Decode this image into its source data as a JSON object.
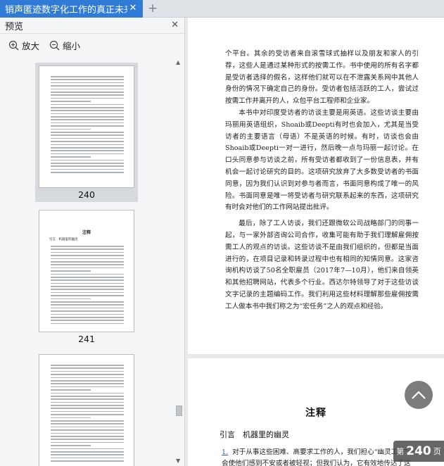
{
  "tab": {
    "title": "销声匿迹数字化工作的真正未来",
    "close": "✕",
    "add": "+"
  },
  "sidebar": {
    "title": "预览",
    "close": "✕",
    "zoom_in": "放大",
    "zoom_out": "缩小",
    "thumbnails": [
      {
        "page": "240"
      },
      {
        "page": "241",
        "title": "注释",
        "subtitle": "引言　机器里的幽灵"
      },
      {
        "page": ""
      }
    ]
  },
  "document": {
    "paragraphs": [
      "个平台。其余的受访者来自滚雪球式抽样以及朋友和家人的引荐，这些人是通过某种形式的按需工作。书中使用的所有名字都是受访者选择的假名，这样他们就可以在不泄露关系网中其他人身份的情况下确定自己的身份。受访者包括活跃的工人，尝试过按需工作并离开的人，众包平台工程师和企业家。",
      "本书中对印度受访者的访谈主要是用英语。这些访谈主要由玛丽用英语组织，Shoaib或Deepti有时也会加入，尤其是当受访者的主要语言（母语）不是英语的时候。有时，访谈也会由Shoaib或Deepti一对一进行，然后晚一点与玛丽一起讨论。在口头同意参与访谈之前，所有受访者都收到了一份信息表，并有机会一起讨论研究的目的。这项研究放弃了大多数受访者的书面同意，因为我们认识到对参与者而言，书面同意构成了唯一的风险。书面同意是唯一将受访者与研究联系起来的东西，这项研究有时会对他们的工作网站提出批评。",
      "最后，除了工人访谈，我们还跟微软公司战略部门的同事一起，与一家外部咨询公司合作，收集可能有助于我们理解雇佣按需工人的观点的访谈。这些访谈不是由我们组织的，但都是当面进行的，在项目记录和转录过程中也有相同的知情同意。这家咨询机构访谈了50名全职雇员（2017年7—10月），他们来自领英和其他招聘网站，代表多个行业。西达尔特领导了对于这些访谈文字记录的主题编码工作。我们利用这些材料理解那些雇佣按需工人做本书中我们称之为“宏任务”之人的观点和经验。"
    ],
    "notes_title": "注释",
    "notes_subtitle": "引言　机器里的幽灵",
    "note1_num": "1.",
    "note1_text": "对于从事这些困难、高要求工作的人，我们担心“幽灵工作”一词会使他们感到不安或者被轻视；但我们认为，它有效地传达了这"
  },
  "pager": {
    "prefix": "第",
    "current": "240",
    "suffix": "页"
  }
}
